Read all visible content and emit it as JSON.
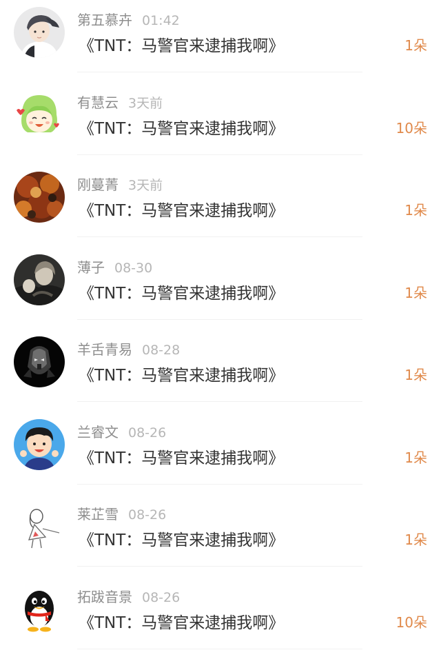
{
  "entries": [
    {
      "user": "第五慕卉",
      "time": "01:42",
      "book": "《TNT：马警官来逮捕我啊》",
      "count": "1朵",
      "avatar_icon": "boy-cap-avatar-icon"
    },
    {
      "user": "有慧云",
      "time": "3天前",
      "book": "《TNT：马警官来逮捕我啊》",
      "count": "10朵",
      "avatar_icon": "green-hair-girl-avatar-icon"
    },
    {
      "user": "刚蔓菁",
      "time": "3天前",
      "book": "《TNT：马警官来逮捕我啊》",
      "count": "1朵",
      "avatar_icon": "autumn-leaves-avatar-icon"
    },
    {
      "user": "薄子",
      "time": "08-30",
      "book": "《TNT：马警官来逮捕我啊》",
      "count": "1朵",
      "avatar_icon": "dark-portrait-avatar-icon"
    },
    {
      "user": "羊舌青易",
      "time": "08-28",
      "book": "《TNT：马警官来逮捕我啊》",
      "count": "1朵",
      "avatar_icon": "robot-mask-avatar-icon"
    },
    {
      "user": "兰睿文",
      "time": "08-26",
      "book": "《TNT：马警官来逮捕我啊》",
      "count": "1朵",
      "avatar_icon": "cartoon-boy-avatar-icon"
    },
    {
      "user": "莱芷雪",
      "time": "08-26",
      "book": "《TNT：马警官来逮捕我啊》",
      "count": "1朵",
      "avatar_icon": "sketch-girl-avatar-icon"
    },
    {
      "user": "拓跋音景",
      "time": "08-26",
      "book": "《TNT：马警官来逮捕我啊》",
      "count": "10朵",
      "avatar_icon": "qq-penguin-avatar-icon"
    }
  ],
  "colors": {
    "username": "#8e8e8e",
    "time": "#b6b6b6",
    "book_title": "#333333",
    "flower_count": "#e0894a",
    "divider": "#f1f1f1"
  }
}
